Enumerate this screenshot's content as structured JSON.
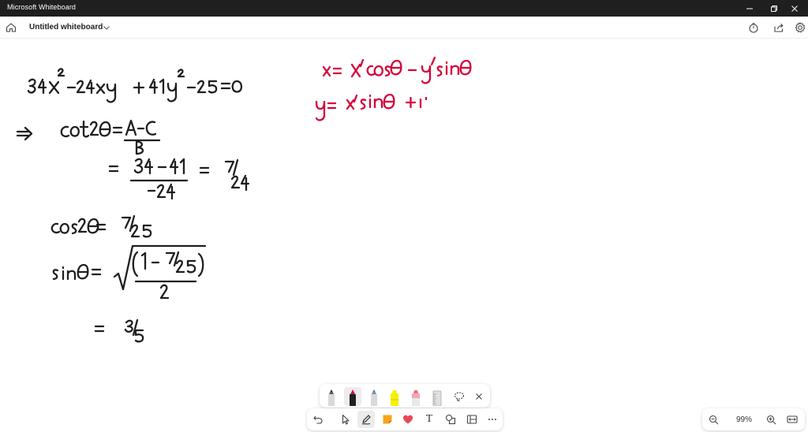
{
  "window": {
    "title": "Microsoft Whiteboard",
    "controls": [
      "minimize-icon",
      "restore-icon",
      "close-icon"
    ]
  },
  "header": {
    "board_name": "Untitled whiteboard",
    "icons": [
      "home-icon",
      "chevron-down-icon",
      "timer-icon",
      "share-icon",
      "gear-icon"
    ]
  },
  "canvas": {
    "ink_color_black": "#1f1f1f",
    "ink_color_red": "#d6003a",
    "handwriting_black": [
      "34x² − 24xy + 41y² − 25 = 0",
      "⇒ cot2θ = (A − C) / B",
      "= (34 − 41) / −24 = 7/24",
      "cos2θ = 7/25",
      "sinθ = √( (1 − 7/25) / 2 )",
      "= 3/5"
    ],
    "handwriting_red": [
      "x = x′cosθ − y′sinθ",
      "y = x′sinθ + …"
    ]
  },
  "pen_tray": {
    "pens": [
      {
        "name": "black-pen",
        "color": "#1f1f1f",
        "selected": false
      },
      {
        "name": "red-pen",
        "color": "#d0103a",
        "selected": true
      },
      {
        "name": "blue-pen",
        "color": "#3a6ea5",
        "selected": false
      },
      {
        "name": "yellow-highlighter",
        "color": "#f5f000",
        "selected": false
      },
      {
        "name": "pink-highlighter",
        "color": "#f4a6b4",
        "selected": false
      },
      {
        "name": "ruler",
        "color": "#bdbdbd",
        "selected": false
      }
    ],
    "icons": [
      "lasso-icon",
      "close-icon"
    ]
  },
  "toolbar": {
    "tools": [
      "undo-icon",
      "select-icon",
      "pen-icon",
      "sticky-note-icon",
      "reactions-heart-icon",
      "text-icon",
      "shapes-icon",
      "templates-icon",
      "more-icon"
    ],
    "text_tool_label": "T",
    "heart_color": "#e74856",
    "sticky_color": "#f7a31c"
  },
  "zoom": {
    "level": "99%",
    "icons": [
      "zoom-out-icon",
      "zoom-in-icon",
      "fit-to-screen-icon"
    ]
  }
}
